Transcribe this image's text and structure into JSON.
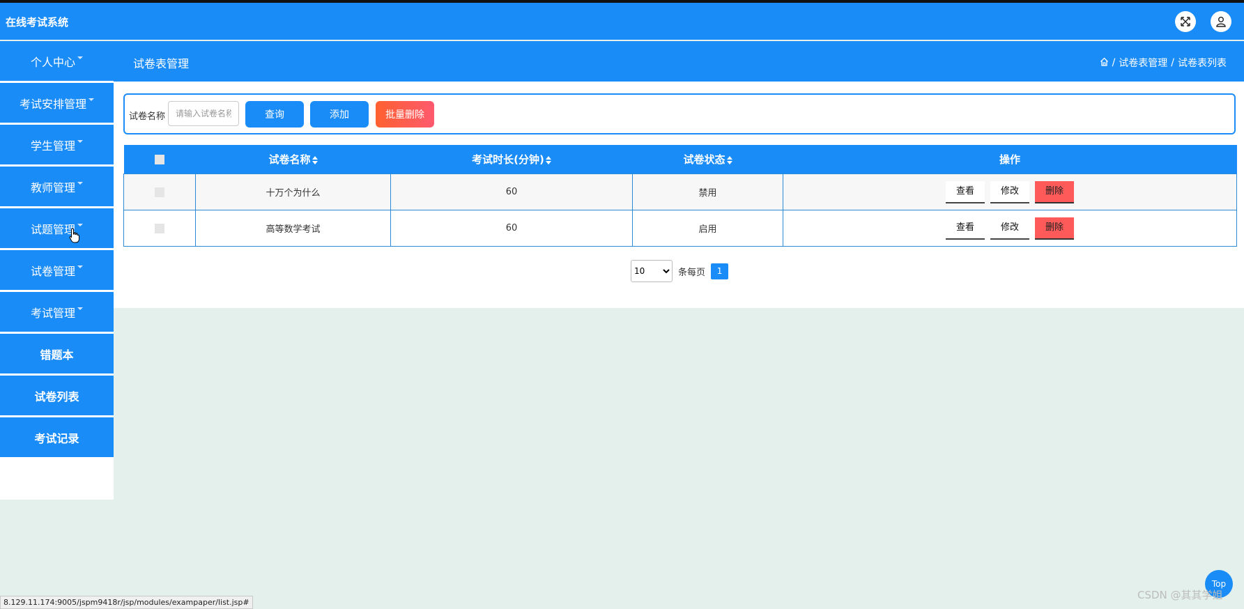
{
  "app": {
    "title": "在线考试系统"
  },
  "header": {
    "page_heading": "试卷表管理",
    "breadcrumb": [
      "试卷表管理",
      "试卷表列表"
    ],
    "breadcrumb_sep": "/"
  },
  "sidebar": {
    "items": [
      {
        "label": "个人中心",
        "dropdown": true
      },
      {
        "label": "考试安排管理",
        "dropdown": true
      },
      {
        "label": "学生管理",
        "dropdown": true
      },
      {
        "label": "教师管理",
        "dropdown": true
      },
      {
        "label": "试题管理",
        "dropdown": true
      },
      {
        "label": "试卷管理",
        "dropdown": true
      },
      {
        "label": "考试管理",
        "dropdown": true
      },
      {
        "label": "错题本",
        "dropdown": false
      },
      {
        "label": "试卷列表",
        "dropdown": false
      },
      {
        "label": "考试记录",
        "dropdown": false
      }
    ]
  },
  "search": {
    "label": "试卷名称",
    "placeholder": "请输入试卷名称",
    "value": "",
    "query_label": "查询",
    "add_label": "添加",
    "batch_delete_label": "批量删除"
  },
  "table": {
    "columns": [
      "试卷名称",
      "考试时长(分钟)",
      "试卷状态",
      "操作"
    ],
    "rows": [
      {
        "name": "十万个为什么",
        "duration": "60",
        "status": "禁用"
      },
      {
        "name": "高等数学考试",
        "duration": "60",
        "status": "启用"
      }
    ],
    "actions": {
      "view": "查看",
      "edit": "修改",
      "delete": "删除"
    }
  },
  "pagination": {
    "page_size": "10",
    "page_size_options": [
      "10"
    ],
    "per_page_label": "条每页",
    "current_page": "1"
  },
  "footer": {
    "top_label": "Top",
    "status_url": "8.129.11.174:9005/jspm9418r/jsp/modules/exampaper/list.jsp#",
    "watermark": "CSDN @其其学姐"
  },
  "colors": {
    "primary": "#1a8cf7",
    "danger": "#ff5a5a",
    "background": "#e4f0ec"
  }
}
